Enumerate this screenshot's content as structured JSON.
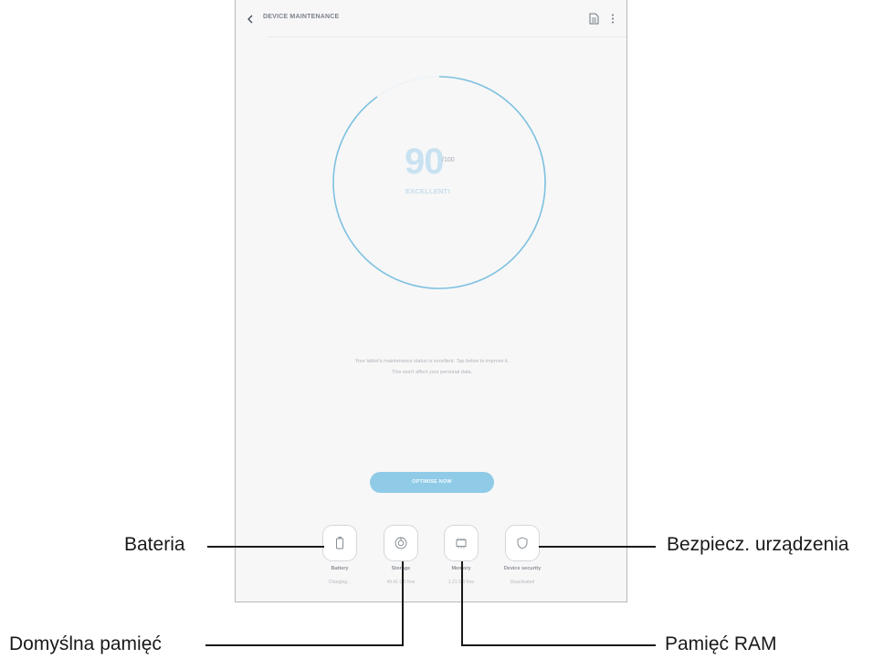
{
  "screen": {
    "title": "DEVICE MAINTENANCE",
    "score": "90",
    "score_max": "/100",
    "score_status": "EXCELLENT!",
    "status_message_line1": "Your tablet's maintenance status is excellent. Tap below to improve it.",
    "status_message_line2": "This won't affect your personal data.",
    "optimise_button": "OPTIMISE NOW",
    "score_fraction": 0.9,
    "accent_color": "#8fcbe7",
    "modules": [
      {
        "icon": "battery-icon",
        "label": "Battery",
        "value": "Charging..."
      },
      {
        "icon": "storage-icon",
        "label": "Storage",
        "value": "49.41 GB free"
      },
      {
        "icon": "memory-icon",
        "label": "Memory",
        "value": "1.21 GB free"
      },
      {
        "icon": "shield-icon",
        "label": "Device security",
        "value": "Deactivated"
      }
    ]
  },
  "callouts": {
    "battery": "Bateria",
    "storage": "Domyślna pamięć",
    "memory": "Pamięć RAM",
    "security": "Bezpiecz. urządzenia"
  }
}
